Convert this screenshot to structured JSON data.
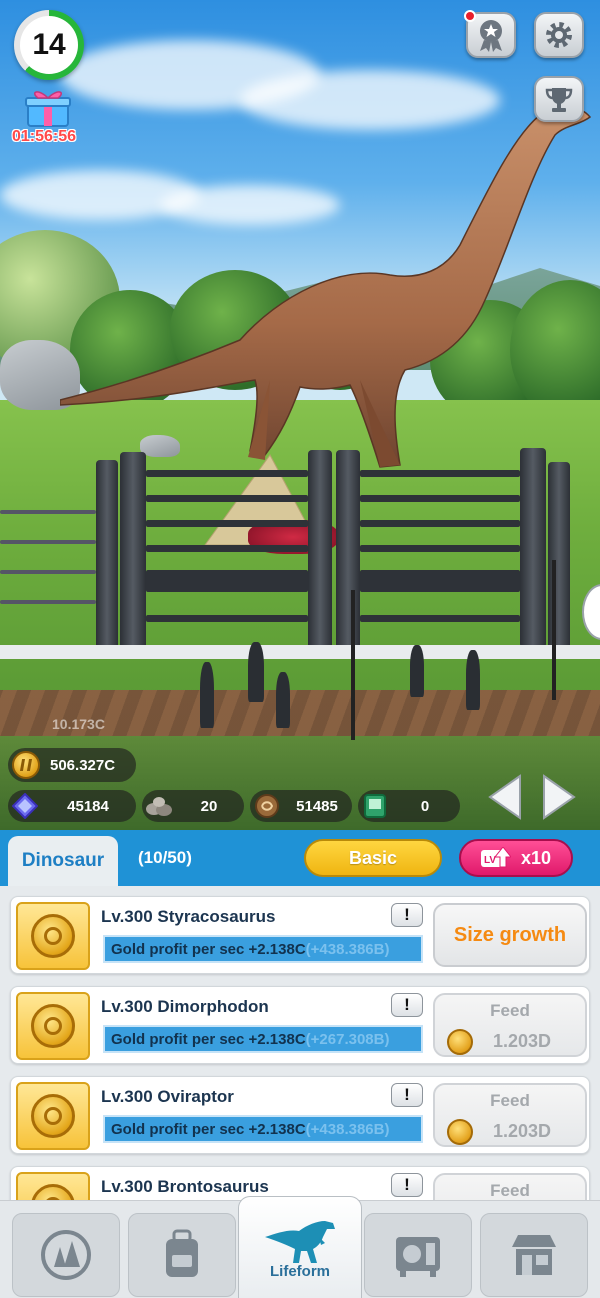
{
  "hud": {
    "level": "14",
    "gift_timer": "01:56:56",
    "scene_floating_text": "10.173C"
  },
  "currency": {
    "gold": "506.327C",
    "gems": "45184",
    "stones": "20",
    "fossils": "51485",
    "tickets": "0"
  },
  "panel": {
    "tab_label": "Dinosaur",
    "count": "(10/50)",
    "mode_label": "Basic",
    "multiplier_label": "x10",
    "multiplier_icon_text": "LV"
  },
  "dinosaurs": [
    {
      "name": "Lv.300 Styracosaurus",
      "profit": "Gold profit per sec +2.138C",
      "delta": "(+438.386B)",
      "info": "!",
      "action": "Size growth"
    },
    {
      "name": "Lv.300 Dimorphodon",
      "profit": "Gold profit per sec +2.138C",
      "delta": "(+267.308B)",
      "info": "!",
      "action": "Feed",
      "cost": "1.203D"
    },
    {
      "name": "Lv.300 Oviraptor",
      "profit": "Gold profit per sec +2.138C",
      "delta": "(+438.386B)",
      "info": "!",
      "action": "Feed",
      "cost": "1.203D"
    },
    {
      "name": "Lv.300 Brontosaurus",
      "profit": "",
      "delta": "",
      "info": "!",
      "action": "Feed"
    }
  ],
  "nav": {
    "items": [
      "Park",
      "Backpack",
      "Lifeform",
      "Lab",
      "Shop"
    ],
    "active_label": "Lifeform"
  },
  "icons": {
    "gift": "gift-box-icon",
    "medal": "medal-icon",
    "settings": "gear-icon",
    "trophy": "trophy-icon"
  },
  "colors": {
    "header_blue": "#1f92d6",
    "basic_yellow": "#efb511",
    "x10_pink": "#e0196b",
    "size_growth_orange": "#f58a12",
    "level_ring_green": "#27b63a"
  }
}
